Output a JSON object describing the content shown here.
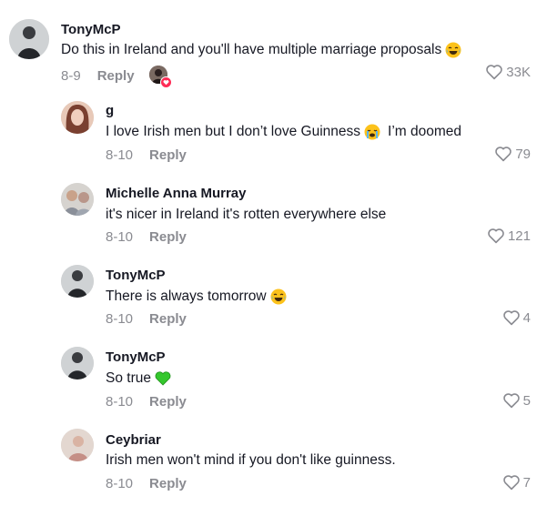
{
  "comments": [
    {
      "user": "TonyMcP",
      "text": "Do this in Ireland and you'll have multiple marriage proposals",
      "emoji": "laughing-tears-emoji",
      "date": "8-9",
      "reply": "Reply",
      "likes": "33K",
      "avatar_color": "#5b5f64"
    },
    {
      "user": "g",
      "text_before": "I love Irish men but I don’t love Guinness",
      "emoji": "crying-face-emoji",
      "text_after": "I’m doomed",
      "date": "8-10",
      "reply": "Reply",
      "likes": "79",
      "avatar_color": "#a66a53"
    },
    {
      "user": "Michelle Anna Murray",
      "text": "it's nicer in Ireland it's rotten everywhere else",
      "date": "8-10",
      "reply": "Reply",
      "likes": "121",
      "avatar_color": "#b8a89c"
    },
    {
      "user": "TonyMcP",
      "text": "There is always tomorrow",
      "emoji": "laughing-tears-emoji",
      "date": "8-10",
      "reply": "Reply",
      "likes": "4",
      "avatar_color": "#5b5f64"
    },
    {
      "user": "TonyMcP",
      "text": "So true",
      "emoji": "green-heart-emoji",
      "date": "8-10",
      "reply": "Reply",
      "likes": "5",
      "avatar_color": "#5b5f64"
    },
    {
      "user": "Ceybriar",
      "text": "Irish men won't mind if you don't like guinness.",
      "date": "8-10",
      "reply": "Reply",
      "likes": "7",
      "avatar_color": "#c9a89a"
    }
  ],
  "colors": {
    "text": "#161823",
    "muted": "#8a8b91",
    "accent": "#fe2c55"
  }
}
